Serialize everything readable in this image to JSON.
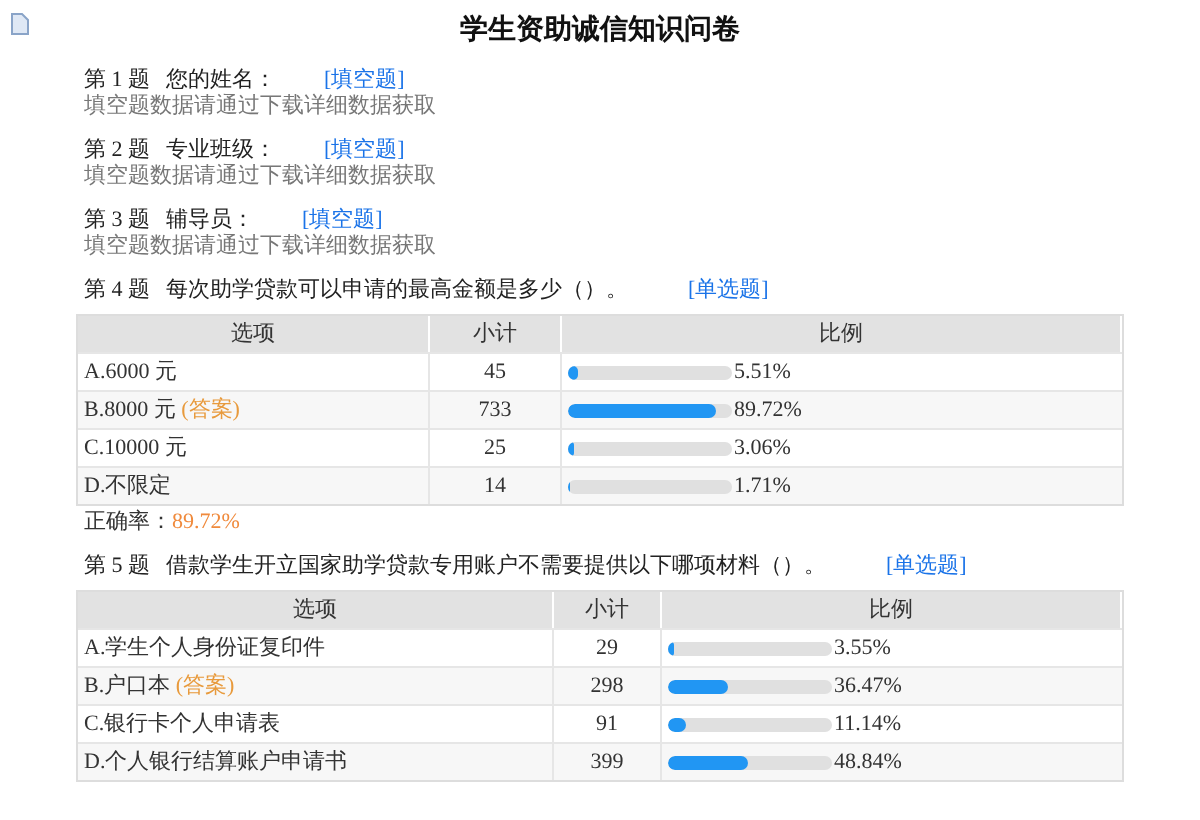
{
  "title": "学生资助诚信知识问卷",
  "questions": [
    {
      "kind": "blank",
      "number": "第 1 题",
      "text": "您的姓名：",
      "type_tag": "[填空题]",
      "hint": "填空题数据请通过下载详细数据获取"
    },
    {
      "kind": "blank",
      "number": "第 2 题",
      "text": "专业班级：",
      "type_tag": "[填空题]",
      "hint": "填空题数据请通过下载详细数据获取"
    },
    {
      "kind": "blank",
      "number": "第 3 题",
      "text": "辅导员：",
      "type_tag": "[填空题]",
      "hint": "填空题数据请通过下载详细数据获取"
    },
    {
      "kind": "choice",
      "number": "第 4 题",
      "text": "每次助学贷款可以申请的最高金额是多少（）。",
      "type_tag": "[单选题]",
      "columns": [
        "选项",
        "小计",
        "比例"
      ],
      "rows": [
        {
          "option": "A.6000 元",
          "count": "45",
          "level": 0.0551,
          "percent": "5.51%"
        },
        {
          "option": "B.8000 元",
          "tag": "(答案)",
          "count": "733",
          "level": 0.8972,
          "percent": "89.72%"
        },
        {
          "option": "C.10000 元",
          "count": "25",
          "level": 0.0306,
          "percent": "3.06%"
        },
        {
          "option": "D.不限定",
          "count": "14",
          "level": 0.0171,
          "percent": "1.71%"
        }
      ],
      "accuracy_label": "正确率：",
      "accuracy": "89.72%"
    },
    {
      "kind": "choice",
      "number": "第 5 题",
      "text": "借款学生开立国家助学贷款专用账户不需要提供以下哪项材料（）。",
      "type_tag": "[单选题]",
      "columns": [
        "选项",
        "小计",
        "比例"
      ],
      "rows": [
        {
          "option": "A.学生个人身份证复印件",
          "count": "29",
          "level": 0.0355,
          "percent": "3.55%"
        },
        {
          "option": "B.户口本",
          "tag": "(答案)",
          "count": "298",
          "level": 0.3647,
          "percent": "36.47%"
        },
        {
          "option": "C.银行卡个人申请表",
          "count": "91",
          "level": 0.1114,
          "percent": "11.14%"
        },
        {
          "option": "D.个人银行结算账户申请书",
          "count": "399",
          "level": 0.4884,
          "percent": "48.84%"
        }
      ]
    }
  ]
}
